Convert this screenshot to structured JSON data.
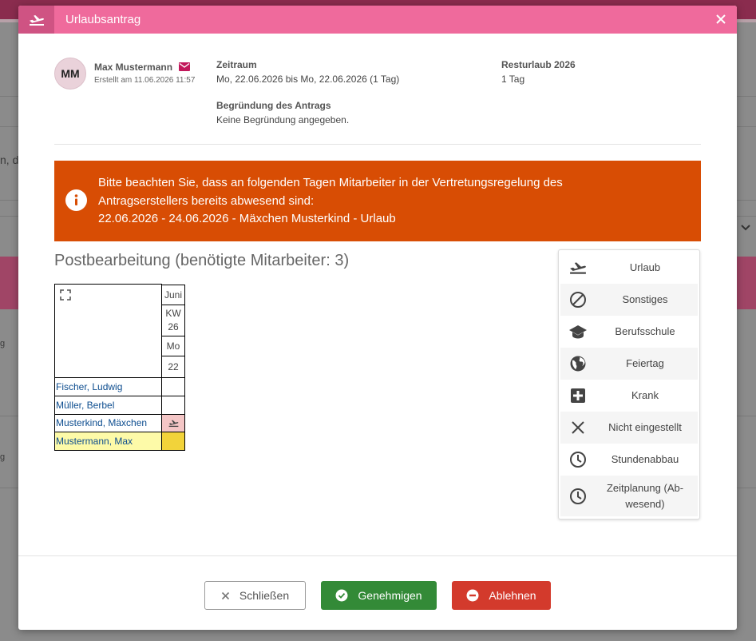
{
  "background": {
    "frag_left_1": "n, de",
    "frag_left_2": "g",
    "frag_left_3": "g"
  },
  "dialog": {
    "title": "Urlaubsantrag",
    "header_icon": "airplane-takeoff-icon",
    "close_icon": "close-icon"
  },
  "applicant": {
    "initials": "MM",
    "name": "Max Mustermann",
    "created": "Erstellt am 11.06.2026 11:57",
    "mail_icon": "envelope-icon"
  },
  "request": {
    "period_label": "Zeitraum",
    "period_value": "Mo, 22.06.2026 bis Mo, 22.06.2026 (1 Tag)",
    "remaining_label": "Resturlaub 2026",
    "remaining_value": "1 Tag",
    "reason_label": "Begründung des Antrags",
    "reason_value": "Keine Begründung angegeben."
  },
  "warning": {
    "line1": "Bitte beachten Sie, dass an folgenden Tagen Mitarbeiter in der Vertretungsregelung des",
    "line2": "Antragserstellers bereits abwesend sind:",
    "line3": "22.06.2026 - 24.06.2026 - Mäxchen Musterkind - Urlaub",
    "color": "#d84d04"
  },
  "schedule": {
    "title": "Postbearbeitung (benötigte Mitarbeiter: 3)",
    "month": "Juni",
    "week_prefix": "KW",
    "week": "26",
    "weekday": "Mo",
    "day": "22",
    "employees": [
      {
        "name": "Fischer, Ludwig",
        "status": "none"
      },
      {
        "name": "Müller, Berbel",
        "status": "none"
      },
      {
        "name": "Musterkind, Mäxchen",
        "status": "urlaub"
      },
      {
        "name": "Mustermann, Max",
        "status": "requested"
      }
    ],
    "colors": {
      "urlaub": "#f4c6c6",
      "requested": "#f2d33a",
      "requested_name": "#fdfaa8"
    }
  },
  "legend": [
    {
      "label": "Urlaub",
      "icon": "airplane-takeoff-icon"
    },
    {
      "label": "Sonstiges",
      "icon": "cancel-circle-icon"
    },
    {
      "label": "Berufsschule",
      "icon": "graduation-cap-icon"
    },
    {
      "label": "Feiertag",
      "icon": "globe-icon"
    },
    {
      "label": "Krank",
      "icon": "medical-cross-icon"
    },
    {
      "label": "Nicht eingestellt",
      "icon": "x-icon"
    },
    {
      "label": "Stundenabbau",
      "icon": "clock-icon"
    },
    {
      "label": "Zeitplanung (Ab-",
      "label2": "wesend)",
      "icon": "clock-icon"
    }
  ],
  "buttons": {
    "close": "Schließen",
    "approve": "Genehmigen",
    "reject": "Ablehnen"
  }
}
